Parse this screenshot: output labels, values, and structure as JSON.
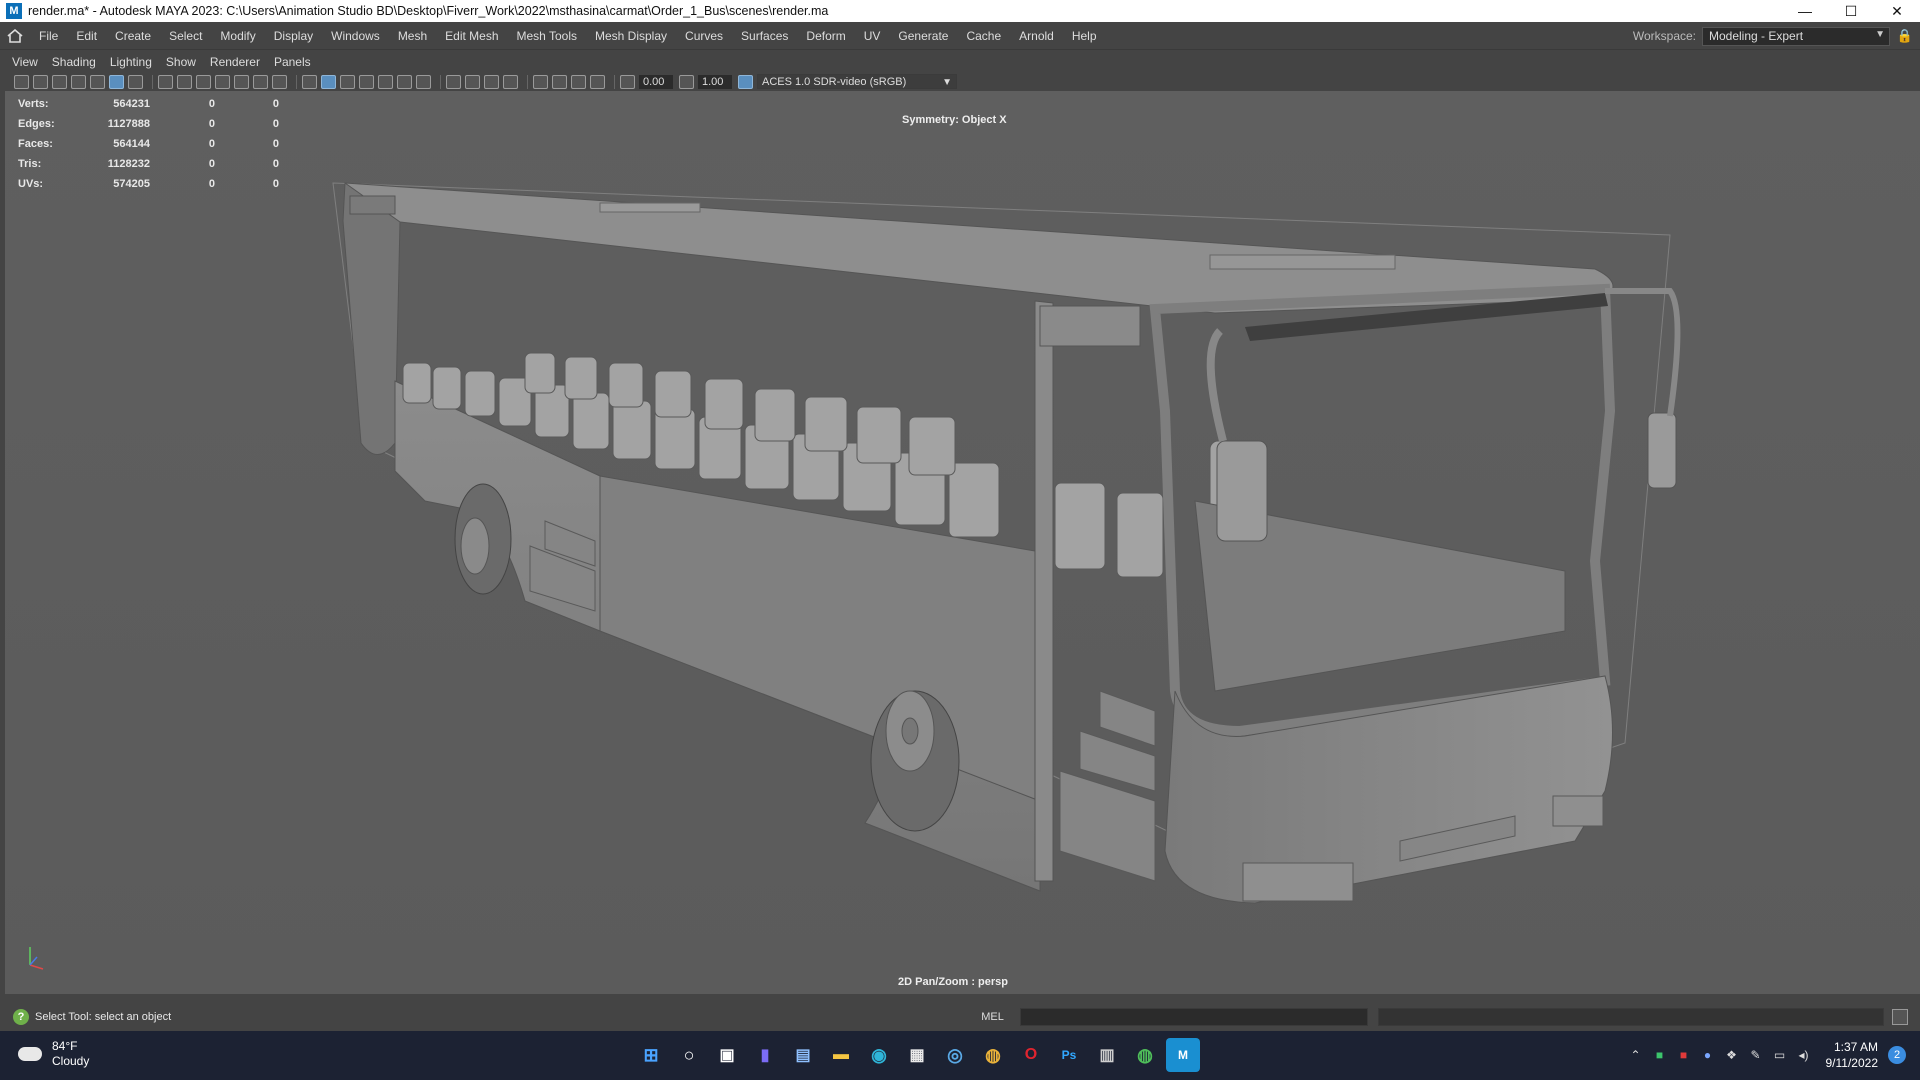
{
  "window": {
    "title": "render.ma* - Autodesk MAYA 2023: C:\\Users\\Animation Studio BD\\Desktop\\Fiverr_Work\\2022\\msthasina\\carmat\\Order_1_Bus\\scenes\\render.ma",
    "app_icon": "M",
    "minimize": "—",
    "maximize": "☐",
    "close": "✕"
  },
  "menubar": {
    "items": [
      "File",
      "Edit",
      "Create",
      "Select",
      "Modify",
      "Display",
      "Windows",
      "Mesh",
      "Edit Mesh",
      "Mesh Tools",
      "Mesh Display",
      "Curves",
      "Surfaces",
      "Deform",
      "UV",
      "Generate",
      "Cache",
      "Arnold",
      "Help"
    ],
    "workspace_label": "Workspace:",
    "workspace_value": "Modeling - Expert"
  },
  "panel_menu": [
    "View",
    "Shading",
    "Lighting",
    "Show",
    "Renderer",
    "Panels"
  ],
  "toolbar": {
    "field1": "0.00",
    "field2": "1.00",
    "color_management": "ACES 1.0 SDR-video (sRGB)"
  },
  "hud": {
    "rows": [
      {
        "label": "Verts:",
        "v1": "564231",
        "v2": "0",
        "v3": "0"
      },
      {
        "label": "Edges:",
        "v1": "1127888",
        "v2": "0",
        "v3": "0"
      },
      {
        "label": "Faces:",
        "v1": "564144",
        "v2": "0",
        "v3": "0"
      },
      {
        "label": "Tris:",
        "v1": "1128232",
        "v2": "0",
        "v3": "0"
      },
      {
        "label": "UVs:",
        "v1": "574205",
        "v2": "0",
        "v3": "0"
      }
    ],
    "symmetry": "Symmetry: Object X",
    "camera": "2D Pan/Zoom : persp"
  },
  "helpline": {
    "text": "Select Tool: select an object",
    "mel_label": "MEL"
  },
  "taskbar": {
    "temp": "84°F",
    "condition": "Cloudy",
    "apps": [
      {
        "name": "start-icon",
        "glyph": "⊞"
      },
      {
        "name": "search-icon",
        "glyph": "○"
      },
      {
        "name": "task-view-icon",
        "glyph": "▣"
      },
      {
        "name": "chat-icon",
        "glyph": "▮"
      },
      {
        "name": "photos-icon",
        "glyph": "▤"
      },
      {
        "name": "file-explorer-icon",
        "glyph": "▬"
      },
      {
        "name": "edge-icon",
        "glyph": "◉"
      },
      {
        "name": "store-icon",
        "glyph": "▦"
      },
      {
        "name": "browser-icon",
        "glyph": "◎"
      },
      {
        "name": "chrome-icon",
        "glyph": "◍"
      },
      {
        "name": "opera-icon",
        "glyph": "O"
      },
      {
        "name": "photoshop-icon",
        "glyph": "Ps"
      },
      {
        "name": "calculator-icon",
        "glyph": "▥"
      },
      {
        "name": "chrome-profile-icon",
        "glyph": "◍"
      },
      {
        "name": "maya-icon",
        "glyph": "M"
      }
    ],
    "time": "1:37 AM",
    "date": "9/11/2022",
    "notifications": "2"
  },
  "colors": {
    "viewport": "#5e5e5e",
    "bus_body": "#8a8a8a",
    "taskbar": "#1c2233",
    "accent": "#5a8fbf"
  }
}
